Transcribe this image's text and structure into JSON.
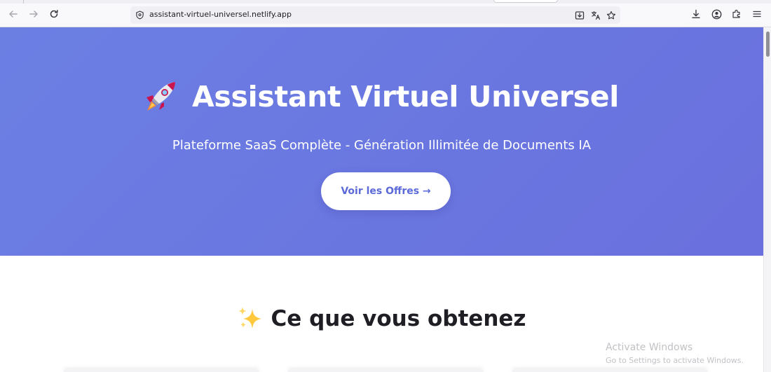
{
  "browser": {
    "url": "assistant-virtuel-universel.netlify.app",
    "icons": [
      "back-arrow-icon",
      "forward-arrow-icon",
      "reload-icon",
      "site-info-icon",
      "install-app-icon",
      "translate-icon",
      "bookmark-star-icon",
      "downloads-icon",
      "account-icon",
      "extensions-icon",
      "menu-icon"
    ]
  },
  "hero": {
    "title": "Assistant Virtuel Universel",
    "title_emoji": "rocket",
    "subtitle": "Plateforme SaaS Complète - Génération Illimitée de Documents IA",
    "cta_label": "Voir les Offres →"
  },
  "features": {
    "title": "Ce que vous obtenez",
    "title_emoji": "sparkles"
  },
  "watermark": {
    "line1": "Activate Windows",
    "line2": "Go to Settings to activate Windows."
  },
  "colors": {
    "hero_gradient_start": "#6b7fe3",
    "hero_gradient_end": "#6a70de",
    "cta_text": "#5b6ad8"
  }
}
